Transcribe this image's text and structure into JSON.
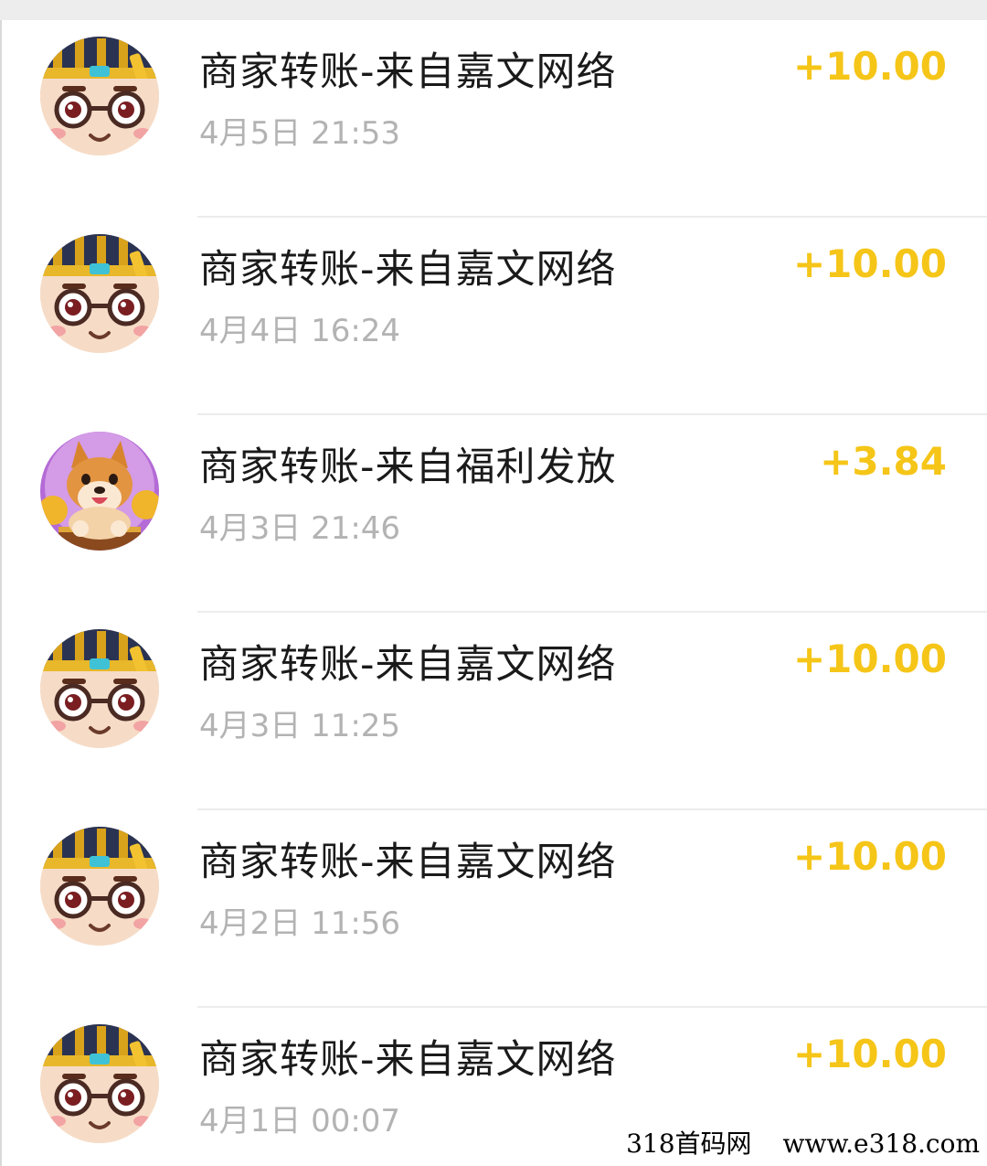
{
  "transactions": [
    {
      "avatar": "nerd-avatar",
      "title": "商家转账-来自嘉文网络",
      "time": "4月5日 21:53",
      "amount": "+10.00"
    },
    {
      "avatar": "nerd-avatar",
      "title": "商家转账-来自嘉文网络",
      "time": "4月4日 16:24",
      "amount": "+10.00"
    },
    {
      "avatar": "dog-avatar",
      "title": "商家转账-来自福利发放",
      "time": "4月3日 21:46",
      "amount": "+3.84"
    },
    {
      "avatar": "nerd-avatar",
      "title": "商家转账-来自嘉文网络",
      "time": "4月3日 11:25",
      "amount": "+10.00"
    },
    {
      "avatar": "nerd-avatar",
      "title": "商家转账-来自嘉文网络",
      "time": "4月2日 11:56",
      "amount": "+10.00"
    },
    {
      "avatar": "nerd-avatar",
      "title": "商家转账-来自嘉文网络",
      "time": "4月1日 00:07",
      "amount": "+10.00"
    }
  ],
  "watermark": {
    "site_name": "318首码网",
    "url": "www.e318.com"
  },
  "colors": {
    "amount": "#f5c518",
    "title": "#1a1a1a",
    "time": "#b3b3b3",
    "divider": "#ececec"
  }
}
